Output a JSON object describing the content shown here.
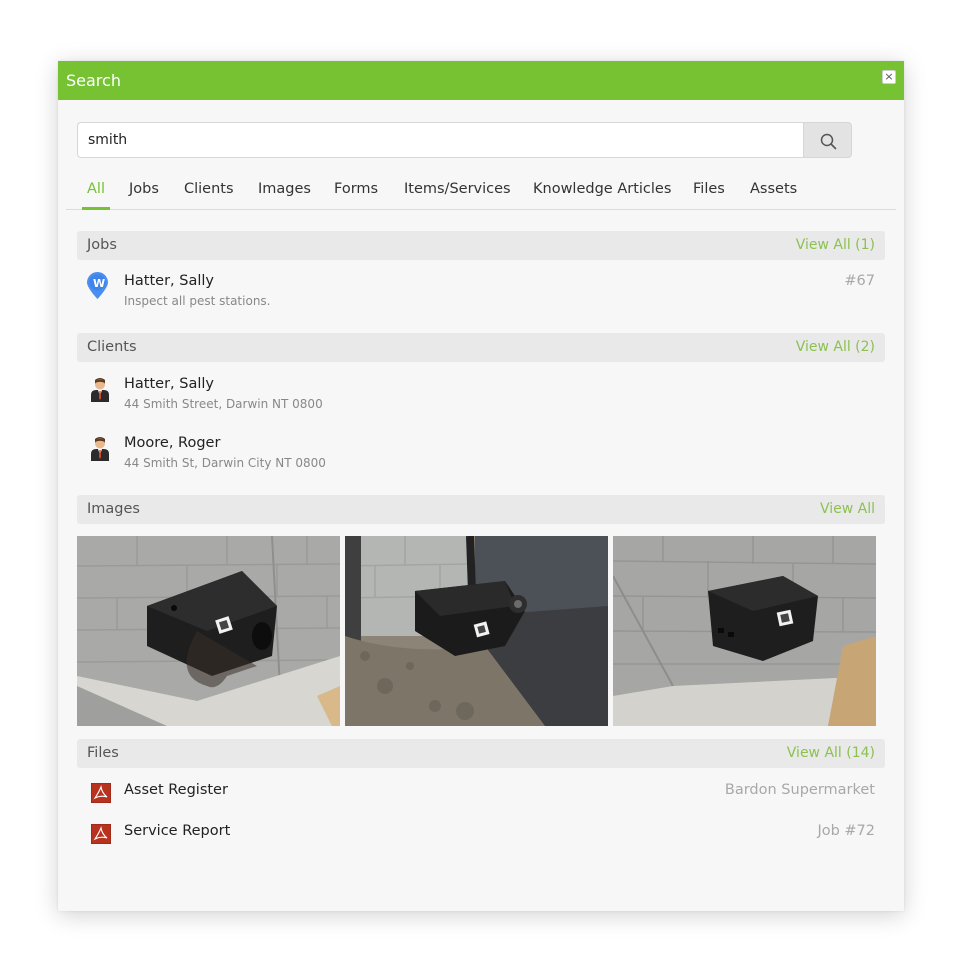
{
  "dialog": {
    "title": "Search",
    "close_symbol": "×"
  },
  "search": {
    "value": "smith",
    "placeholder": "",
    "button_icon": "search-icon"
  },
  "tabs": [
    {
      "label": "All",
      "active": true
    },
    {
      "label": "Jobs"
    },
    {
      "label": "Clients"
    },
    {
      "label": "Images"
    },
    {
      "label": "Forms"
    },
    {
      "label": "Items/Services"
    },
    {
      "label": "Knowledge Articles"
    },
    {
      "label": "Files"
    },
    {
      "label": "Assets"
    }
  ],
  "sections": {
    "jobs": {
      "label": "Jobs",
      "view_all": "View All (1)",
      "items": [
        {
          "title": "Hatter, Sally",
          "subtitle": "Inspect all pest stations.",
          "ref": "#67",
          "icon": "map-pin-icon",
          "pin_letter": "W"
        }
      ]
    },
    "clients": {
      "label": "Clients",
      "view_all": "View All (2)",
      "items": [
        {
          "title": "Hatter, Sally",
          "subtitle": "44 Smith Street, Darwin NT 0800",
          "icon": "person-icon"
        },
        {
          "title": "Moore, Roger",
          "subtitle": "44 Smith St, Darwin City NT 0800",
          "icon": "person-icon"
        }
      ]
    },
    "images": {
      "label": "Images",
      "view_all": "View All",
      "items": [
        {
          "icon": "bait-station-photo"
        },
        {
          "icon": "bait-station-photo"
        },
        {
          "icon": "bait-station-photo"
        }
      ]
    },
    "files": {
      "label": "Files",
      "view_all": "View All (14)",
      "items": [
        {
          "title": "Asset Register",
          "context": "Bardon Supermarket",
          "icon": "pdf-icon"
        },
        {
          "title": "Service Report",
          "context": "Job #72",
          "icon": "pdf-icon"
        }
      ]
    }
  },
  "colors": {
    "accent": "#76c233",
    "link": "#8cc152",
    "pin": "#4a8ff0",
    "pdf": "#c0392b"
  }
}
